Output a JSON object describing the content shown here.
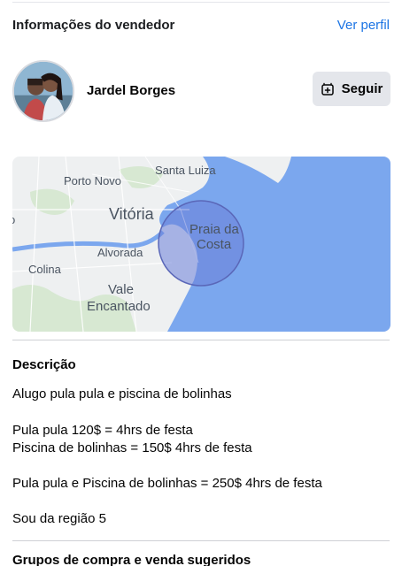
{
  "seller": {
    "section_title": "Informações do vendedor",
    "view_profile_label": "Ver perfil",
    "name": "Jardel Borges",
    "follow_label": "Seguir"
  },
  "map": {
    "labels": {
      "santa_luiza": "Santa Luiza",
      "porto_novo": "Porto Novo",
      "vitoria": "Vitória",
      "praia_da": "Praia da",
      "costa": "Costa",
      "alvorada": "Alvorada",
      "colina": "Colina",
      "vale": "Vale",
      "encantado": "Encantado",
      "edge_letter": "o"
    },
    "colors": {
      "water": "#7ba7ee",
      "land": "#eef0f1",
      "radius_fill": "#6c7fd8"
    }
  },
  "description": {
    "title": "Descrição",
    "lines": [
      "Alugo pula pula e piscina de bolinhas",
      "Pula pula 120$ = 4hrs de festa",
      "Piscina de bolinhas = 150$ 4hrs de festa",
      "Pula pula e Piscina de bolinhas = 250$ 4hrs de festa",
      "Sou da região 5"
    ]
  },
  "groups": {
    "title": "Grupos de compra e venda sugeridos"
  }
}
